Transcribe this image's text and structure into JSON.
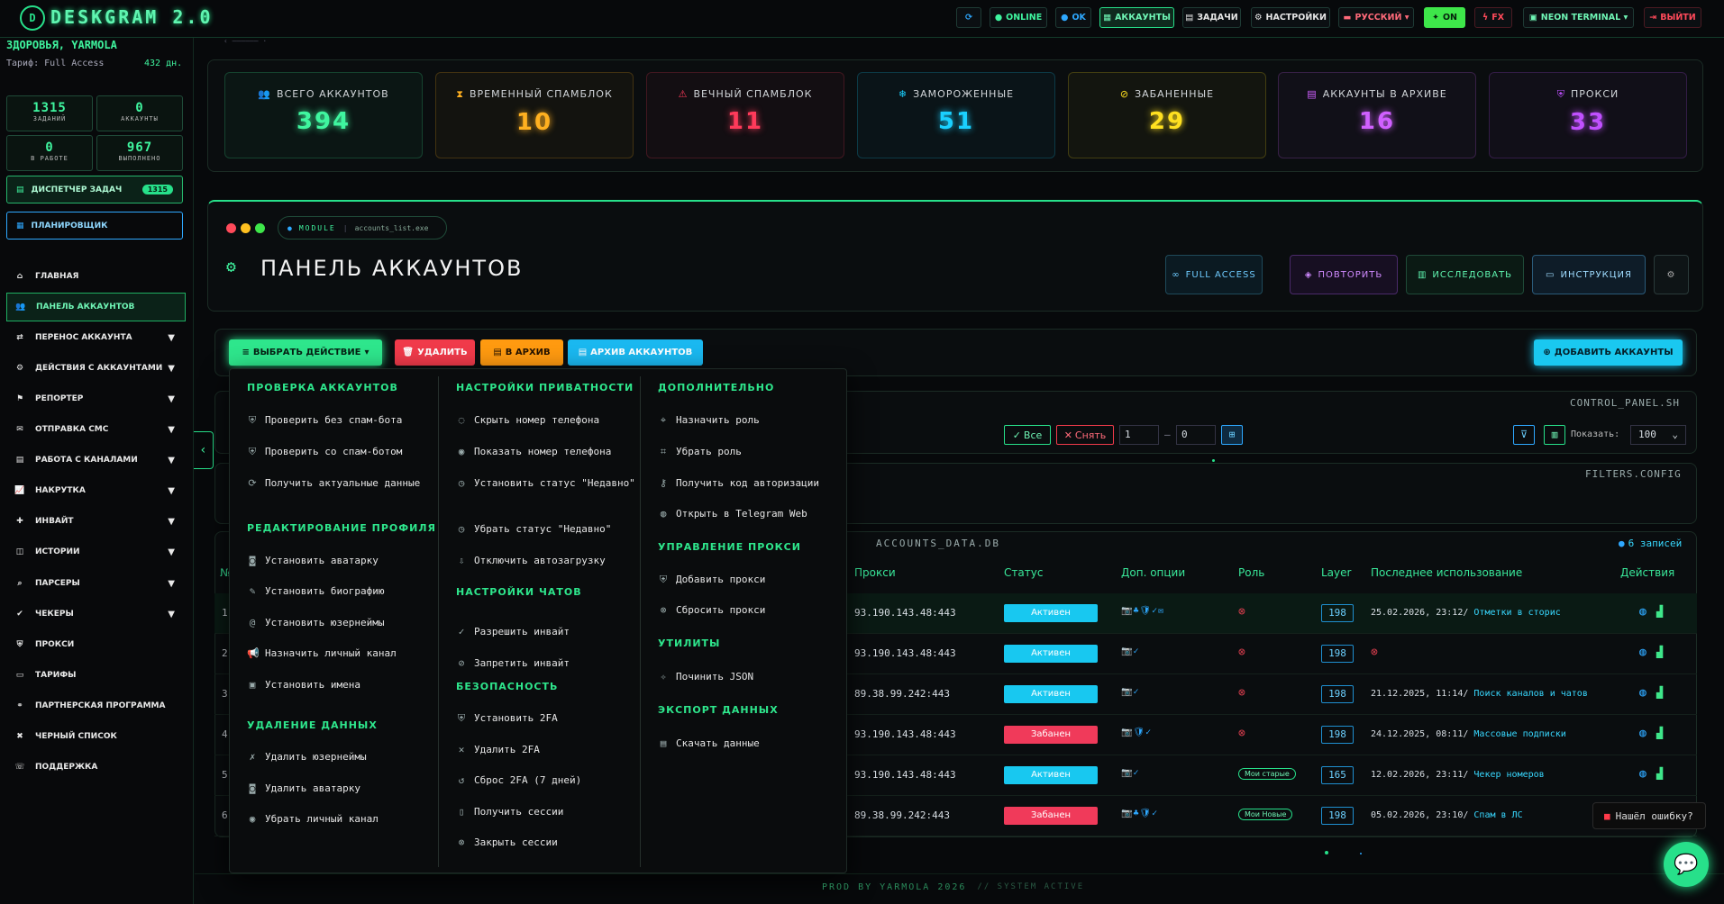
{
  "app": {
    "title": "DESKGRAM 2.0"
  },
  "topbar": {
    "items": [
      {
        "label": "",
        "icon": "refresh-icon"
      },
      {
        "label": "ONLINE",
        "icon": "status-dot"
      },
      {
        "label": "OK",
        "icon": "status-dot"
      },
      {
        "label": "АККАУНТЫ",
        "icon": "accounts-icon"
      },
      {
        "label": "ЗАДАЧИ",
        "icon": "tasks-icon"
      },
      {
        "label": "НАСТРОЙКИ",
        "icon": "gear-icon"
      },
      {
        "label": "РУССКИЙ ▾",
        "icon": "flag-ru-icon"
      },
      {
        "label": "ON",
        "icon": "pin-icon"
      },
      {
        "label": "FX",
        "icon": "bolt-icon"
      },
      {
        "label": "NEON TERMINAL ▾",
        "icon": "terminal-icon"
      },
      {
        "label": "ВЫЙТИ",
        "icon": "logout-icon"
      }
    ]
  },
  "sidebar": {
    "user": "ЗДОРОВЬЯ, YARMOLA",
    "tarif": "Тариф: Full Access",
    "days": "432 дн.",
    "stats": [
      {
        "value": "1315",
        "label": "ЗАДАНИЙ"
      },
      {
        "value": "0",
        "label": "АККАУНТЫ"
      },
      {
        "value": "0",
        "label": "В РАБОТЕ"
      },
      {
        "value": "967",
        "label": "ВЫПОЛНЕНО"
      }
    ],
    "dispatcher": "ДИСПЕТЧЕР ЗАДАЧ",
    "dispatcher_count": "1315",
    "scheduler": "ПЛАНИРОВЩИК",
    "nav": [
      {
        "label": "ГЛАВНАЯ",
        "icon": "home-icon",
        "arrow": false
      },
      {
        "label": "ПАНЕЛЬ АККАУНТОВ",
        "icon": "users-icon",
        "arrow": false
      },
      {
        "label": "ПЕРЕНОС АККАУНТА",
        "icon": "transfer-icon",
        "arrow": true
      },
      {
        "label": "ДЕЙСТВИЯ С АККАУНТАМИ",
        "icon": "user-cog-icon",
        "arrow": true
      },
      {
        "label": "РЕПОРТЕР",
        "icon": "flag-icon",
        "arrow": true
      },
      {
        "label": "ОТПРАВКА СМС",
        "icon": "chat-icon",
        "arrow": true
      },
      {
        "label": "РАБОТА С КАНАЛАМИ",
        "icon": "channel-icon",
        "arrow": true
      },
      {
        "label": "НАКРУТКА",
        "icon": "chart-icon",
        "arrow": true
      },
      {
        "label": "ИНВАЙТ",
        "icon": "invite-icon",
        "arrow": true
      },
      {
        "label": "ИСТОРИИ",
        "icon": "stories-icon",
        "arrow": true
      },
      {
        "label": "ПАРСЕРЫ",
        "icon": "search-icon",
        "arrow": true
      },
      {
        "label": "ЧЕКЕРЫ",
        "icon": "check-icon",
        "arrow": true
      },
      {
        "label": "ПРОКСИ",
        "icon": "shield-icon",
        "arrow": false
      },
      {
        "label": "ТАРИФЫ",
        "icon": "tariff-icon",
        "arrow": false
      },
      {
        "label": "ПАРТНЕРСКАЯ ПРОГРАММА",
        "icon": "partners-icon",
        "arrow": false
      },
      {
        "label": "ЧЕРНЫЙ СПИСОК",
        "icon": "blacklist-icon",
        "arrow": false
      },
      {
        "label": "ПОДДЕРЖКА",
        "icon": "support-icon",
        "arrow": false
      }
    ]
  },
  "stat_cards": [
    {
      "title": "ВСЕГО АККАУНТОВ",
      "value": "394",
      "icon": "users-icon",
      "color": "#3ff59f"
    },
    {
      "title": "ВРЕМЕННЫЙ СПАМБЛОК",
      "value": "10",
      "icon": "hourglass-icon",
      "color": "#ffb020"
    },
    {
      "title": "ВЕЧНЫЙ СПАМБЛОК",
      "value": "11",
      "icon": "shield-alert-icon",
      "color": "#ff3a5a"
    },
    {
      "title": "ЗАМОРОЖЕННЫЕ",
      "value": "51",
      "icon": "snowflake-icon",
      "color": "#1ad0ff"
    },
    {
      "title": "ЗАБАНЕННЫЕ",
      "value": "29",
      "icon": "ban-icon",
      "color": "#ffe020"
    },
    {
      "title": "АККАУНТЫ В АРХИВЕ",
      "value": "16",
      "icon": "archive-icon",
      "color": "#d060ff"
    },
    {
      "title": "ПРОКСИ",
      "value": "33",
      "icon": "shield-icon",
      "color": "#c050ff"
    }
  ],
  "module": {
    "label": "MODULE",
    "file": "accounts_list.exe"
  },
  "panel": {
    "title": "ПАНЕЛЬ АККАУНТОВ",
    "buttons": [
      "FULL ACCESS",
      "ПОВТОРИТЬ",
      "ИССЛЕДОВАТЬ",
      "ИНСТРУКЦИЯ"
    ]
  },
  "actions": {
    "choose": "ВЫБРАТЬ ДЕЙСТВИЕ",
    "delete": "УДАЛИТЬ",
    "archive": "В АРХИВ",
    "archive_accounts": "АРХИВ АККАУНТОВ",
    "add": "ДОБАВИТЬ АККАУНТЫ"
  },
  "control": {
    "file": "CONTROL_PANEL.SH",
    "all": "Все",
    "unset": "Снять",
    "from": "1",
    "to": "0",
    "show_label": "Показать:",
    "show_value": "100"
  },
  "filters": {
    "file": "FILTERS.CONFIG"
  },
  "dropdown": {
    "col1": [
      {
        "header": "ПРОВЕРКА АККАУНТОВ",
        "items": [
          {
            "icon": "shield-check-icon",
            "label": "Проверить без спам-бота"
          },
          {
            "icon": "shield-check-icon",
            "label": "Проверить со спам-ботом"
          },
          {
            "icon": "refresh-icon",
            "label": "Получить актуальные данные"
          }
        ]
      },
      {
        "header": "РЕДАКТИРОВАНИЕ ПРОФИЛЯ",
        "items": [
          {
            "icon": "camera-icon",
            "label": "Установить аватарку"
          },
          {
            "icon": "bio-icon",
            "label": "Установить биографию"
          },
          {
            "icon": "at-icon",
            "label": "Установить юзернеймы"
          },
          {
            "icon": "megaphone-icon",
            "label": "Назначить личный канал"
          },
          {
            "icon": "id-icon",
            "label": "Установить имена"
          }
        ]
      },
      {
        "header": "УДАЛЕНИЕ ДАННЫХ",
        "items": [
          {
            "icon": "user-x-icon",
            "label": "Удалить юзернеймы"
          },
          {
            "icon": "camera-icon",
            "label": "Удалить аватарку"
          },
          {
            "icon": "broadcast-icon",
            "label": "Убрать личный канал"
          }
        ]
      }
    ],
    "col2": [
      {
        "header": "НАСТРОЙКИ ПРИВАТНОСТИ",
        "items": [
          {
            "icon": "eye-off-icon",
            "label": "Скрыть номер телефона"
          },
          {
            "icon": "eye-icon",
            "label": "Показать номер телефона"
          },
          {
            "icon": "clock-icon",
            "label": "Установить статус \"Недавно\""
          },
          {
            "icon": "clock-icon",
            "label": "Убрать статус \"Недавно\""
          },
          {
            "icon": "download-icon",
            "label": "Отключить автозагрузку"
          }
        ]
      },
      {
        "header": "НАСТРОЙКИ ЧАТОВ",
        "items": [
          {
            "icon": "check-circle-icon",
            "label": "Разрешить инвайт"
          },
          {
            "icon": "ban-icon",
            "label": "Запретить инвайт"
          }
        ]
      },
      {
        "header": "БЕЗОПАСНОСТЬ",
        "items": [
          {
            "icon": "shield-icon",
            "label": "Установить 2FA"
          },
          {
            "icon": "trash-icon",
            "label": "Удалить 2FA"
          },
          {
            "icon": "reset-icon",
            "label": "Сброс 2FA (7 дней)"
          },
          {
            "icon": "phone-icon",
            "label": "Получить сессии"
          },
          {
            "icon": "close-circle-icon",
            "label": "Закрыть сессии"
          }
        ]
      }
    ],
    "col3": [
      {
        "header": "ДОПОЛНИТЕЛЬНО",
        "items": [
          {
            "icon": "tag-icon",
            "label": "Назначить роль"
          },
          {
            "icon": "tag-off-icon",
            "label": "Убрать роль"
          },
          {
            "icon": "key-icon",
            "label": "Получить код авторизации"
          },
          {
            "icon": "globe-icon",
            "label": "Открыть в Telegram Web"
          }
        ]
      },
      {
        "header": "УПРАВЛЕНИЕ ПРОКСИ",
        "items": [
          {
            "icon": "shield-icon",
            "label": "Добавить прокси"
          },
          {
            "icon": "close-circle-icon",
            "label": "Сбросить прокси"
          }
        ]
      },
      {
        "header": "УТИЛИТЫ",
        "items": [
          {
            "icon": "wrench-icon",
            "label": "Починить JSON"
          }
        ]
      },
      {
        "header": "ЭКСПОРТ ДАННЫХ",
        "items": [
          {
            "icon": "file-icon",
            "label": "Скачать данные"
          }
        ]
      }
    ]
  },
  "table": {
    "file": "ACCOUNTS_DATA.DB",
    "records": "6 записей",
    "headers": [
      "№",
      "Прокси",
      "Статус",
      "Доп. опции",
      "Роль",
      "Layer",
      "Последнее использование",
      "Действия"
    ],
    "rows": [
      {
        "n": "1",
        "proxy": "93.190.143.48:443",
        "status": "Активен",
        "status_color": "#18c8f0",
        "opts": "📷♣🛡✓✉",
        "role": "",
        "layer": "198",
        "last_date": "25.02.2026, 23:12/",
        "last_task": "Отметки в сторис"
      },
      {
        "n": "2",
        "proxy": "93.190.143.48:443",
        "status": "Активен",
        "status_color": "#18c8f0",
        "opts": "📷✓",
        "role": "",
        "layer": "198",
        "last_date": "",
        "last_task": ""
      },
      {
        "n": "3",
        "proxy": "89.38.99.242:443",
        "status": "Активен",
        "status_color": "#18c8f0",
        "opts": "📷✓",
        "role": "",
        "layer": "198",
        "last_date": "21.12.2025, 11:14/",
        "last_task": "Поиск каналов и чатов"
      },
      {
        "n": "4",
        "proxy": "93.190.143.48:443",
        "status": "Забанен",
        "status_color": "#f03a5a",
        "opts": "📷🛡✓",
        "role": "",
        "layer": "198",
        "last_date": "24.12.2025, 08:11/",
        "last_task": "Массовые подписки"
      },
      {
        "n": "5",
        "proxy": "93.190.143.48:443",
        "status": "Активен",
        "status_color": "#18c8f0",
        "opts": "📷✓",
        "role": "Мои старые",
        "layer": "165",
        "last_date": "12.02.2026, 23:11/",
        "last_task": "Чекер номеров"
      },
      {
        "n": "6",
        "proxy": "89.38.99.242:443",
        "status": "Забанен",
        "status_color": "#f03a5a",
        "opts": "📷♣🛡✓",
        "role": "Мои Новые",
        "layer": "198",
        "last_date": "05.02.2026, 23:10/",
        "last_task": "Спам в ЛС"
      }
    ]
  },
  "footer": {
    "prod": "PROD BY YARMOLA 2026",
    "status": "// SYSTEM ACTIVE"
  },
  "bug_report": "Нашёл ошибку?"
}
